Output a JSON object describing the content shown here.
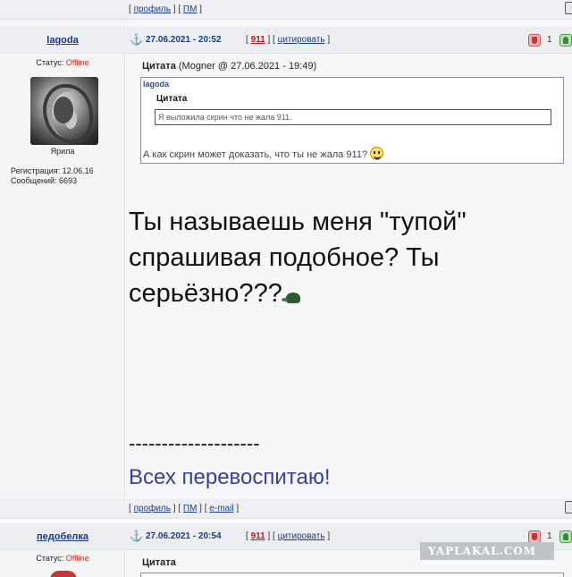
{
  "post1": {
    "top_links": {
      "profile": "профиль",
      "pm": "ПМ"
    },
    "nick": "lagoda",
    "datetime": "27.06.2021 - 20:52",
    "reply_count": "911",
    "quote_link": "цитировать",
    "rating": "1",
    "status_label": "Статус:",
    "status_value": "Offline",
    "rank": "Ярила",
    "registration": "Регистрация: 12.06.16",
    "messages": "Сообщений: 6693",
    "quote_heading": "Цитата",
    "quote_meta": "(Mogner @ 27.06.2021 - 19:49)",
    "quote_author": "lagoda",
    "inner_quote_heading": "Цитата",
    "inner_quote_text": "Я выложила скрин что не жала 911.",
    "quote_reply": "А как скрин может доказать, что ты не жала 911?",
    "body_text": "Ты называешь меня \"тупой\" спрашивая подобное? Ты серьёзно???",
    "signature_divider": "--------------------",
    "signature": "Всех перевоспитаю!",
    "bottom_links": {
      "profile": "профиль",
      "pm": "ПМ",
      "email": "e-mail"
    }
  },
  "post2": {
    "nick": "педобелка",
    "datetime": "27.06.2021 - 20:54",
    "reply_count": "911",
    "quote_link": "цитировать",
    "rating": "1",
    "status_label": "Статус:",
    "status_value": "Offline",
    "quote_heading": "Цитата"
  },
  "watermark": "YAPLAKAL.COM",
  "icons": {
    "anchor": "anchor-icon",
    "vote_down": "thumbs-down-icon",
    "vote_up": "thumbs-up-icon",
    "smile": "smile-emoticon-icon",
    "turtle": "turtle-emoticon-icon"
  }
}
